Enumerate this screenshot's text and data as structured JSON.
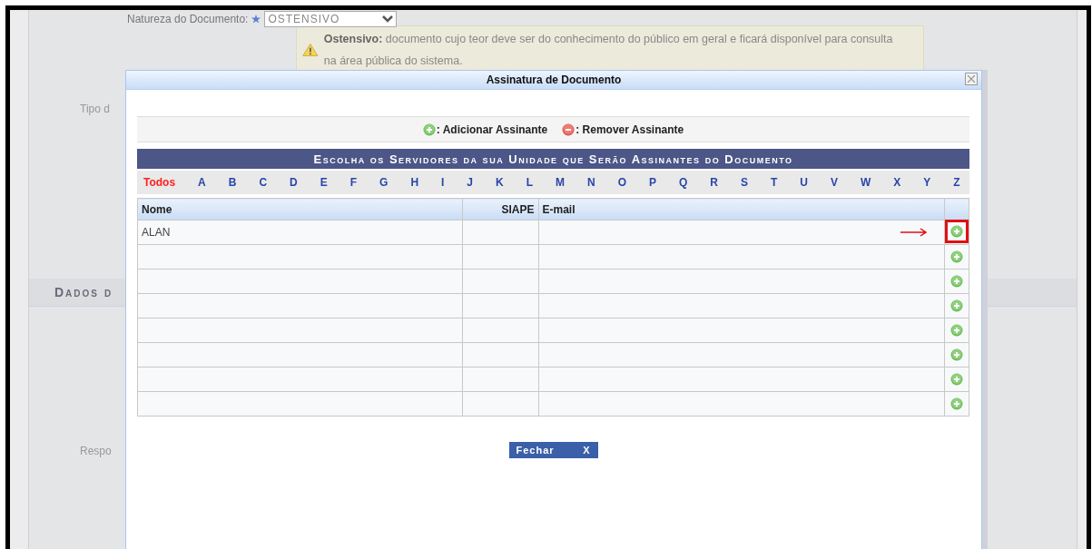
{
  "background": {
    "field_label": "Natureza do Documento:",
    "required": true,
    "select_value": "OSTENSIVO",
    "notice": "**Ostensivo:** documento cujo teor deve ser do conhecimento do público em geral e ficará disponível para consulta na área pública do sistema.",
    "tipo_label": "Tipo d",
    "section_title": "Dados d",
    "respo_label": "Respo"
  },
  "dialog": {
    "title": "Assinatura de Documento",
    "legend": [
      {
        "kind": "add",
        "text": ": Adicionar Assinante"
      },
      {
        "kind": "remove",
        "text": ": Remover Assinante"
      }
    ],
    "heading": "Escolha os Servidores da sua Unidade que Serão Assinantes do Documento",
    "letters": [
      {
        "label": "Todos",
        "selected": true
      },
      {
        "label": "A",
        "selected": false
      },
      {
        "label": "B",
        "selected": false
      },
      {
        "label": "C",
        "selected": false
      },
      {
        "label": "D",
        "selected": false
      },
      {
        "label": "E",
        "selected": false
      },
      {
        "label": "F",
        "selected": false
      },
      {
        "label": "G",
        "selected": false
      },
      {
        "label": "H",
        "selected": false
      },
      {
        "label": "I",
        "selected": false
      },
      {
        "label": "J",
        "selected": false
      },
      {
        "label": "K",
        "selected": false
      },
      {
        "label": "L",
        "selected": false
      },
      {
        "label": "M",
        "selected": false
      },
      {
        "label": "N",
        "selected": false
      },
      {
        "label": "O",
        "selected": false
      },
      {
        "label": "P",
        "selected": false
      },
      {
        "label": "Q",
        "selected": false
      },
      {
        "label": "R",
        "selected": false
      },
      {
        "label": "S",
        "selected": false
      },
      {
        "label": "T",
        "selected": false
      },
      {
        "label": "U",
        "selected": false
      },
      {
        "label": "V",
        "selected": false
      },
      {
        "label": "W",
        "selected": false
      },
      {
        "label": "X",
        "selected": false
      },
      {
        "label": "Y",
        "selected": false
      },
      {
        "label": "Z",
        "selected": false
      }
    ],
    "columns": [
      "Nome",
      "SIAPE",
      "E-mail"
    ],
    "rows": [
      {
        "nome": "ALAN",
        "highlighted": true
      },
      {
        "highlighted": false
      },
      {
        "highlighted": false
      },
      {
        "highlighted": false
      },
      {
        "highlighted": false
      },
      {
        "highlighted": false
      },
      {
        "highlighted": false
      },
      {
        "highlighted": false
      }
    ],
    "close_button": {
      "label": "Fechar",
      "icon": "X"
    }
  }
}
